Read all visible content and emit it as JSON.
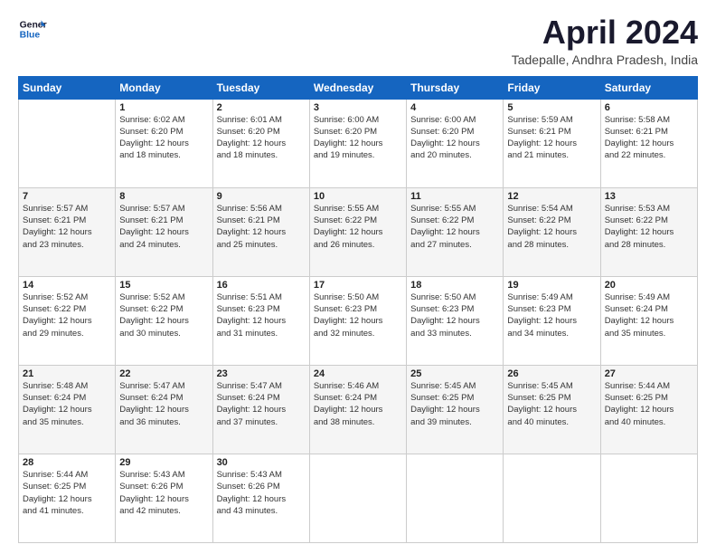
{
  "logo": {
    "line1": "General",
    "line2": "Blue"
  },
  "title": "April 2024",
  "location": "Tadepalle, Andhra Pradesh, India",
  "weekdays": [
    "Sunday",
    "Monday",
    "Tuesday",
    "Wednesday",
    "Thursday",
    "Friday",
    "Saturday"
  ],
  "weeks": [
    [
      {
        "day": "",
        "info": ""
      },
      {
        "day": "1",
        "info": "Sunrise: 6:02 AM\nSunset: 6:20 PM\nDaylight: 12 hours\nand 18 minutes."
      },
      {
        "day": "2",
        "info": "Sunrise: 6:01 AM\nSunset: 6:20 PM\nDaylight: 12 hours\nand 18 minutes."
      },
      {
        "day": "3",
        "info": "Sunrise: 6:00 AM\nSunset: 6:20 PM\nDaylight: 12 hours\nand 19 minutes."
      },
      {
        "day": "4",
        "info": "Sunrise: 6:00 AM\nSunset: 6:20 PM\nDaylight: 12 hours\nand 20 minutes."
      },
      {
        "day": "5",
        "info": "Sunrise: 5:59 AM\nSunset: 6:21 PM\nDaylight: 12 hours\nand 21 minutes."
      },
      {
        "day": "6",
        "info": "Sunrise: 5:58 AM\nSunset: 6:21 PM\nDaylight: 12 hours\nand 22 minutes."
      }
    ],
    [
      {
        "day": "7",
        "info": "Sunrise: 5:57 AM\nSunset: 6:21 PM\nDaylight: 12 hours\nand 23 minutes."
      },
      {
        "day": "8",
        "info": "Sunrise: 5:57 AM\nSunset: 6:21 PM\nDaylight: 12 hours\nand 24 minutes."
      },
      {
        "day": "9",
        "info": "Sunrise: 5:56 AM\nSunset: 6:21 PM\nDaylight: 12 hours\nand 25 minutes."
      },
      {
        "day": "10",
        "info": "Sunrise: 5:55 AM\nSunset: 6:22 PM\nDaylight: 12 hours\nand 26 minutes."
      },
      {
        "day": "11",
        "info": "Sunrise: 5:55 AM\nSunset: 6:22 PM\nDaylight: 12 hours\nand 27 minutes."
      },
      {
        "day": "12",
        "info": "Sunrise: 5:54 AM\nSunset: 6:22 PM\nDaylight: 12 hours\nand 28 minutes."
      },
      {
        "day": "13",
        "info": "Sunrise: 5:53 AM\nSunset: 6:22 PM\nDaylight: 12 hours\nand 28 minutes."
      }
    ],
    [
      {
        "day": "14",
        "info": "Sunrise: 5:52 AM\nSunset: 6:22 PM\nDaylight: 12 hours\nand 29 minutes."
      },
      {
        "day": "15",
        "info": "Sunrise: 5:52 AM\nSunset: 6:22 PM\nDaylight: 12 hours\nand 30 minutes."
      },
      {
        "day": "16",
        "info": "Sunrise: 5:51 AM\nSunset: 6:23 PM\nDaylight: 12 hours\nand 31 minutes."
      },
      {
        "day": "17",
        "info": "Sunrise: 5:50 AM\nSunset: 6:23 PM\nDaylight: 12 hours\nand 32 minutes."
      },
      {
        "day": "18",
        "info": "Sunrise: 5:50 AM\nSunset: 6:23 PM\nDaylight: 12 hours\nand 33 minutes."
      },
      {
        "day": "19",
        "info": "Sunrise: 5:49 AM\nSunset: 6:23 PM\nDaylight: 12 hours\nand 34 minutes."
      },
      {
        "day": "20",
        "info": "Sunrise: 5:49 AM\nSunset: 6:24 PM\nDaylight: 12 hours\nand 35 minutes."
      }
    ],
    [
      {
        "day": "21",
        "info": "Sunrise: 5:48 AM\nSunset: 6:24 PM\nDaylight: 12 hours\nand 35 minutes."
      },
      {
        "day": "22",
        "info": "Sunrise: 5:47 AM\nSunset: 6:24 PM\nDaylight: 12 hours\nand 36 minutes."
      },
      {
        "day": "23",
        "info": "Sunrise: 5:47 AM\nSunset: 6:24 PM\nDaylight: 12 hours\nand 37 minutes."
      },
      {
        "day": "24",
        "info": "Sunrise: 5:46 AM\nSunset: 6:24 PM\nDaylight: 12 hours\nand 38 minutes."
      },
      {
        "day": "25",
        "info": "Sunrise: 5:45 AM\nSunset: 6:25 PM\nDaylight: 12 hours\nand 39 minutes."
      },
      {
        "day": "26",
        "info": "Sunrise: 5:45 AM\nSunset: 6:25 PM\nDaylight: 12 hours\nand 40 minutes."
      },
      {
        "day": "27",
        "info": "Sunrise: 5:44 AM\nSunset: 6:25 PM\nDaylight: 12 hours\nand 40 minutes."
      }
    ],
    [
      {
        "day": "28",
        "info": "Sunrise: 5:44 AM\nSunset: 6:25 PM\nDaylight: 12 hours\nand 41 minutes."
      },
      {
        "day": "29",
        "info": "Sunrise: 5:43 AM\nSunset: 6:26 PM\nDaylight: 12 hours\nand 42 minutes."
      },
      {
        "day": "30",
        "info": "Sunrise: 5:43 AM\nSunset: 6:26 PM\nDaylight: 12 hours\nand 43 minutes."
      },
      {
        "day": "",
        "info": ""
      },
      {
        "day": "",
        "info": ""
      },
      {
        "day": "",
        "info": ""
      },
      {
        "day": "",
        "info": ""
      }
    ]
  ]
}
